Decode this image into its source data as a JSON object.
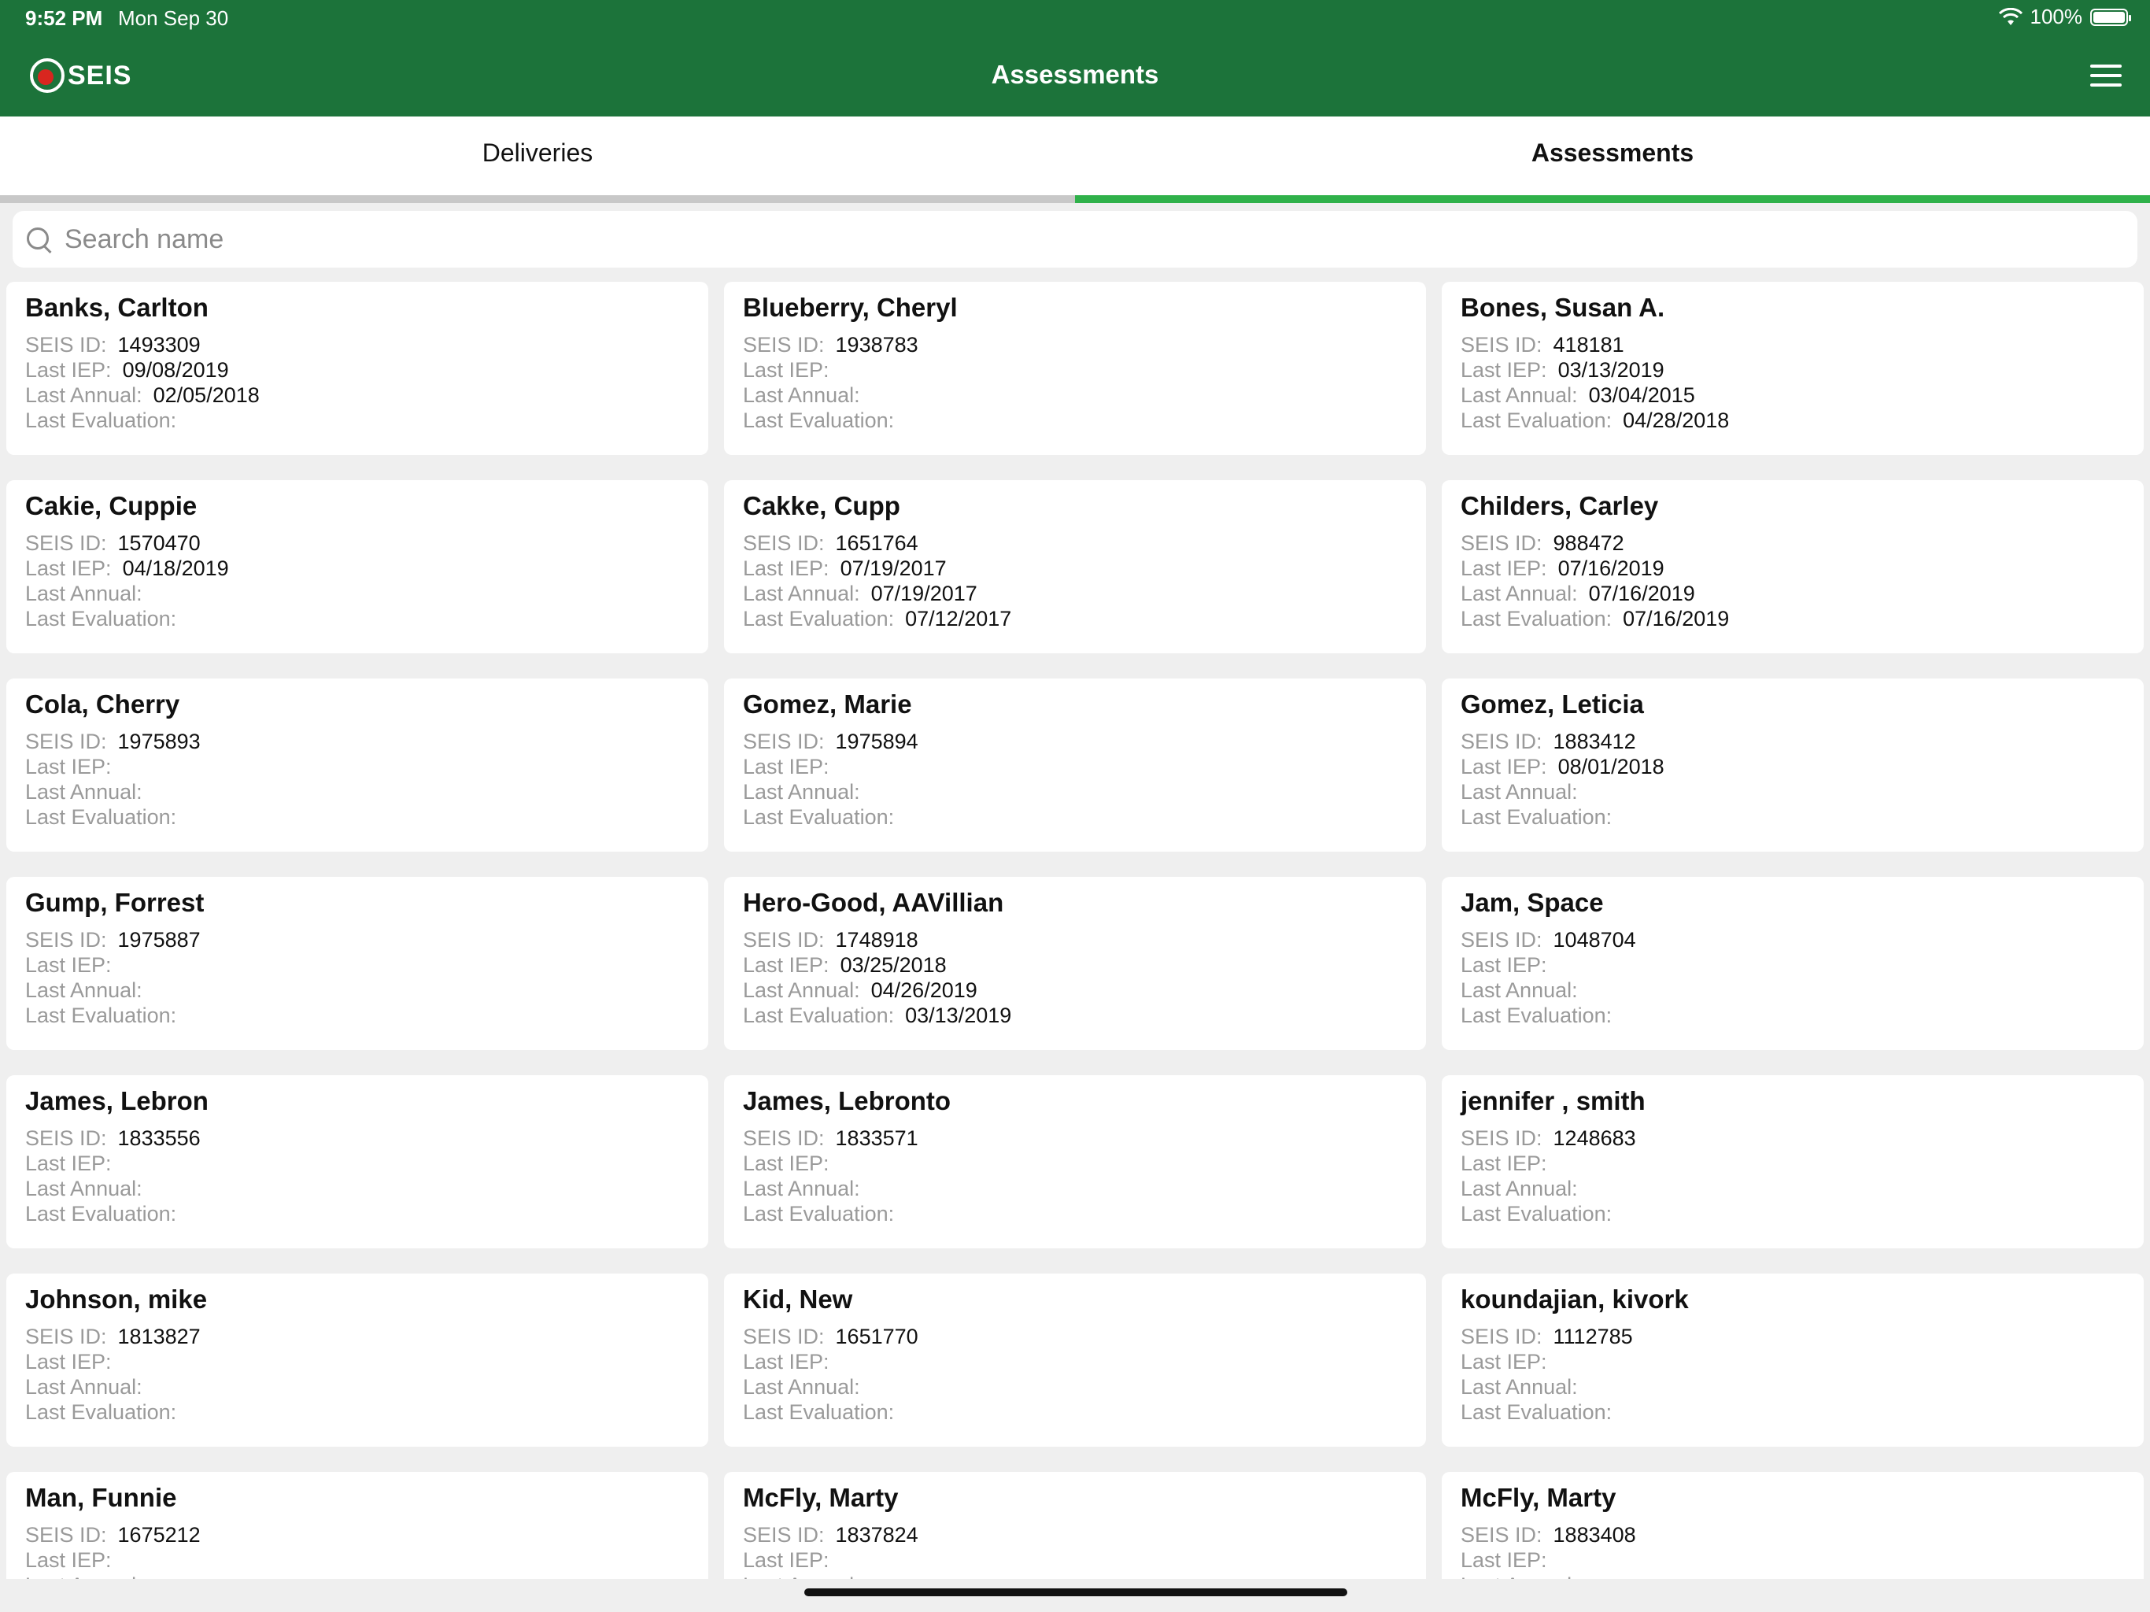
{
  "status": {
    "time": "9:52 PM",
    "date": "Mon Sep 30",
    "battery": "100%"
  },
  "header": {
    "logo_text": "SEIS",
    "title": "Assessments"
  },
  "tabs": [
    {
      "label": "Deliveries",
      "active": false
    },
    {
      "label": "Assessments",
      "active": true
    }
  ],
  "search": {
    "placeholder": "Search name",
    "value": ""
  },
  "labels": {
    "seis_id": "SEIS ID:",
    "last_iep": "Last IEP:",
    "last_annual": "Last Annual:",
    "last_eval": "Last Evaluation:"
  },
  "students": [
    {
      "name": "Banks, Carlton",
      "seis_id": "1493309",
      "last_iep": "09/08/2019",
      "last_annual": "02/05/2018",
      "last_eval": ""
    },
    {
      "name": "Blueberry, Cheryl",
      "seis_id": "1938783",
      "last_iep": "",
      "last_annual": "",
      "last_eval": ""
    },
    {
      "name": "Bones, Susan A.",
      "seis_id": "418181",
      "last_iep": "03/13/2019",
      "last_annual": "03/04/2015",
      "last_eval": "04/28/2018"
    },
    {
      "name": "Cakie, Cuppie",
      "seis_id": "1570470",
      "last_iep": "04/18/2019",
      "last_annual": "",
      "last_eval": ""
    },
    {
      "name": "Cakke, Cupp",
      "seis_id": "1651764",
      "last_iep": "07/19/2017",
      "last_annual": "07/19/2017",
      "last_eval": "07/12/2017"
    },
    {
      "name": "Childers, Carley",
      "seis_id": "988472",
      "last_iep": "07/16/2019",
      "last_annual": "07/16/2019",
      "last_eval": "07/16/2019"
    },
    {
      "name": "Cola, Cherry",
      "seis_id": "1975893",
      "last_iep": "",
      "last_annual": "",
      "last_eval": ""
    },
    {
      "name": "Gomez, Marie",
      "seis_id": "1975894",
      "last_iep": "",
      "last_annual": "",
      "last_eval": ""
    },
    {
      "name": "Gomez, Leticia",
      "seis_id": "1883412",
      "last_iep": "08/01/2018",
      "last_annual": "",
      "last_eval": ""
    },
    {
      "name": "Gump, Forrest",
      "seis_id": "1975887",
      "last_iep": "",
      "last_annual": "",
      "last_eval": ""
    },
    {
      "name": "Hero-Good, AAVillian",
      "seis_id": "1748918",
      "last_iep": "03/25/2018",
      "last_annual": "04/26/2019",
      "last_eval": "03/13/2019"
    },
    {
      "name": "Jam, Space",
      "seis_id": "1048704",
      "last_iep": "",
      "last_annual": "",
      "last_eval": ""
    },
    {
      "name": "James, Lebron",
      "seis_id": "1833556",
      "last_iep": "",
      "last_annual": "",
      "last_eval": ""
    },
    {
      "name": "James, Lebronto",
      "seis_id": "1833571",
      "last_iep": "",
      "last_annual": "",
      "last_eval": ""
    },
    {
      "name": "jennifer , smith",
      "seis_id": "1248683",
      "last_iep": "",
      "last_annual": "",
      "last_eval": ""
    },
    {
      "name": "Johnson, mike",
      "seis_id": "1813827",
      "last_iep": "",
      "last_annual": "",
      "last_eval": ""
    },
    {
      "name": "Kid, New",
      "seis_id": "1651770",
      "last_iep": "",
      "last_annual": "",
      "last_eval": ""
    },
    {
      "name": "koundajian, kivork",
      "seis_id": "1112785",
      "last_iep": "",
      "last_annual": "",
      "last_eval": ""
    },
    {
      "name": "Man, Funnie",
      "seis_id": "1675212",
      "last_iep": "",
      "last_annual": "",
      "last_eval": ""
    },
    {
      "name": "McFly, Marty",
      "seis_id": "1837824",
      "last_iep": "",
      "last_annual": "",
      "last_eval": ""
    },
    {
      "name": "McFly, Marty",
      "seis_id": "1883408",
      "last_iep": "",
      "last_annual": "",
      "last_eval": ""
    }
  ],
  "colors": {
    "header": "#1c733a",
    "tab_active": "#2fb14a",
    "tab_inactive": "#c8c8c8",
    "background": "#efefef"
  }
}
